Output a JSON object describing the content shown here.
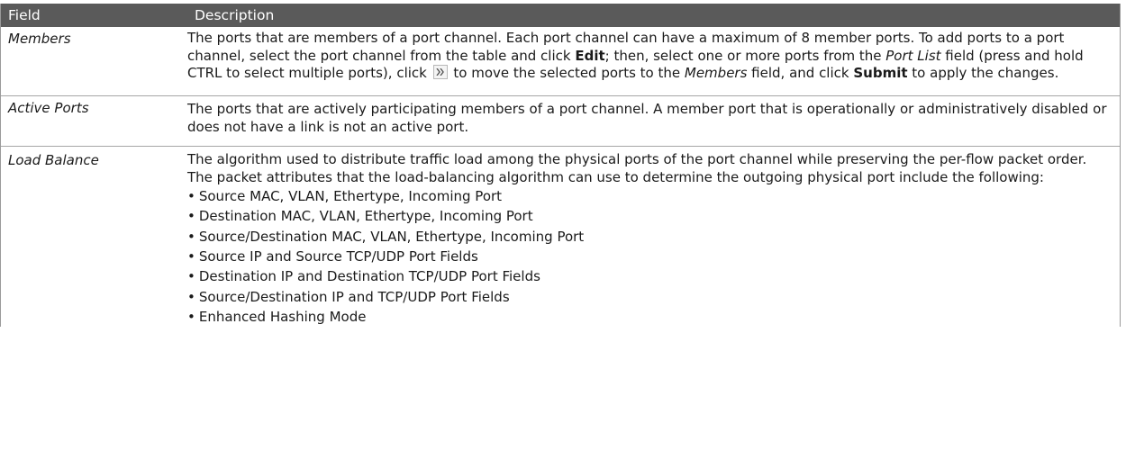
{
  "header": {
    "field": "Field",
    "description": "Description"
  },
  "rows": [
    {
      "field": "Members",
      "parts": [
        "The ports that are members of a port channel. Each port channel can have a maximum of 8 member ports. To add ports to a port channel, select the port channel from the table and click ",
        "Edit",
        "; then, select one or more ports from the ",
        "Port List",
        " field (press and hold CTRL to select multiple ports), click ",
        " to move the selected ports to the ",
        "Members",
        " field, and click ",
        "Submit",
        " to apply the changes."
      ],
      "icon": "double-chevron-right-icon"
    },
    {
      "field": "Active Ports",
      "description": "The ports that are actively participating members of a port channel. A member port that is operationally or administratively disabled or does not have a link is not an active port."
    },
    {
      "field": "Load Balance",
      "description": "The algorithm used to distribute traffic load among the physical ports of the port channel while preserving the per-flow packet order. The packet attributes that the load-balancing algorithm can use to determine the outgoing physical port include the following:",
      "options": [
        "Source MAC, VLAN, Ethertype, Incoming Port",
        "Destination MAC, VLAN, Ethertype, Incoming Port",
        "Source/Destination MAC, VLAN, Ethertype, Incoming Port",
        "Source IP and Source TCP/UDP Port Fields",
        "Destination IP and Destination TCP/UDP Port Fields",
        "Source/Destination IP and TCP/UDP Port Fields",
        "Enhanced Hashing Mode"
      ]
    }
  ],
  "colors": {
    "header_bg": "#5a5a5a",
    "header_text": "#ffffff",
    "border": "#a6a6a6"
  }
}
